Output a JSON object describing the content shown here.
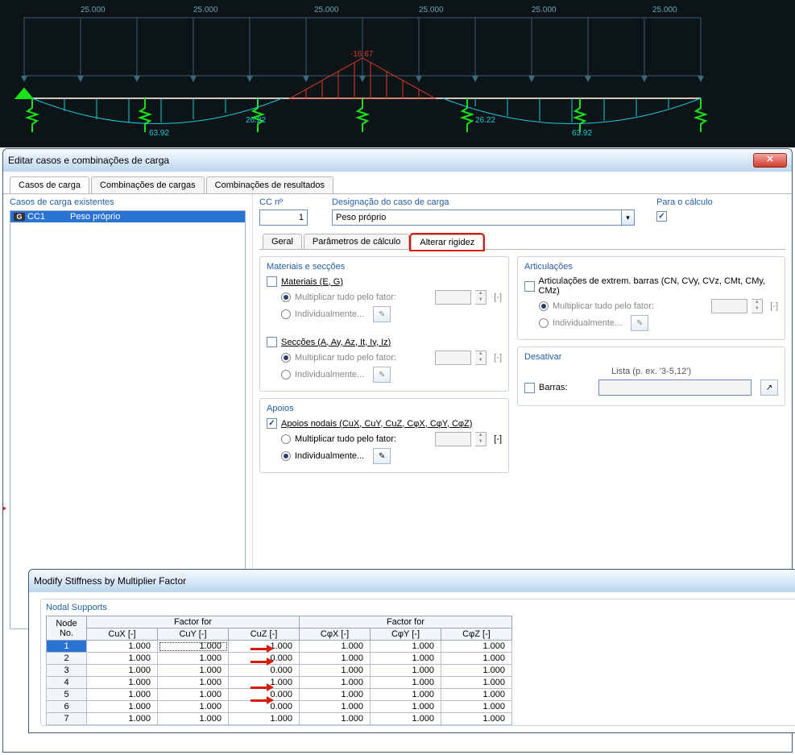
{
  "diagram": {
    "load_labels": [
      "25.000",
      "25.000",
      "25.000",
      "25.000",
      "25.000",
      "25.000"
    ],
    "midspan_label": "-16.67",
    "moment_labels_pos": [
      "63.92",
      "63.92"
    ],
    "moment_labels_neg": [
      "26.22",
      "26.22"
    ]
  },
  "dialog1": {
    "title": "Editar casos e combinações de carga",
    "tabs": [
      "Casos de carga",
      "Combinações de cargas",
      "Combinações de resultados"
    ],
    "leftpanel": {
      "heading": "Casos de carga existentes",
      "rows": [
        {
          "badge": "G",
          "code": "CC1",
          "name": "Peso próprio"
        }
      ]
    },
    "ccnum_label": "CC nº",
    "ccnum_value": "1",
    "desig_label": "Designação do caso de carga",
    "desig_value": "Peso próprio",
    "calc_label": "Para o cálculo",
    "subtabs": [
      "Geral",
      "Parâmetros de cálculo",
      "Alterar rigidez"
    ],
    "groups": {
      "materials_sections": {
        "title": "Materiais e secções",
        "materials_chk": "Materiais (E, G)",
        "multiply": "Multiplicar tudo pelo fator:",
        "individually": "Individualmente...",
        "unit": "[-]",
        "sections_chk": "Secções (A, Ay, Az, It, Iy, Iz)"
      },
      "joints": {
        "title": "Articulações",
        "chk": "Articulações de extrem. barras (CN, CVy, CVz, CMt, CMy, CMz)",
        "multiply": "Multiplicar tudo pelo fator:",
        "individually": "Individualmente...",
        "unit": "[-]"
      },
      "deactivate": {
        "title": "Desativar",
        "list_hint": "Lista (p. ex. '3-5,12')",
        "bars_chk": "Barras:"
      },
      "supports": {
        "title": "Apoios",
        "chk": "Apoios nodais (CuX, CuY, CuZ, CφX, CφY, CφZ)",
        "multiply": "Multiplicar tudo pelo fator:",
        "individually": "Individualmente...",
        "unit": "[-]"
      }
    }
  },
  "dialog2": {
    "title": "Modify Stiffness by Multiplier Factor",
    "group_title": "Nodal Supports",
    "header_node": "Node\nNo.",
    "header_factorfor": "Factor for",
    "cols": [
      "CuX [-]",
      "CuY [-]",
      "CuZ [-]",
      "CφX [-]",
      "CφY [-]",
      "CφZ [-]"
    ],
    "rows": [
      {
        "n": "1",
        "v": [
          "1.000",
          "1.000",
          "1.000",
          "1.000",
          "1.000",
          "1.000"
        ]
      },
      {
        "n": "2",
        "v": [
          "1.000",
          "1.000",
          "0.000",
          "1.000",
          "1.000",
          "1.000"
        ]
      },
      {
        "n": "3",
        "v": [
          "1.000",
          "1.000",
          "0.000",
          "1.000",
          "1.000",
          "1.000"
        ]
      },
      {
        "n": "4",
        "v": [
          "1.000",
          "1.000",
          "1.000",
          "1.000",
          "1.000",
          "1.000"
        ]
      },
      {
        "n": "5",
        "v": [
          "1.000",
          "1.000",
          "0.000",
          "1.000",
          "1.000",
          "1.000"
        ]
      },
      {
        "n": "6",
        "v": [
          "1.000",
          "1.000",
          "0.000",
          "1.000",
          "1.000",
          "1.000"
        ]
      },
      {
        "n": "7",
        "v": [
          "1.000",
          "1.000",
          "1.000",
          "1.000",
          "1.000",
          "1.000"
        ]
      }
    ]
  }
}
